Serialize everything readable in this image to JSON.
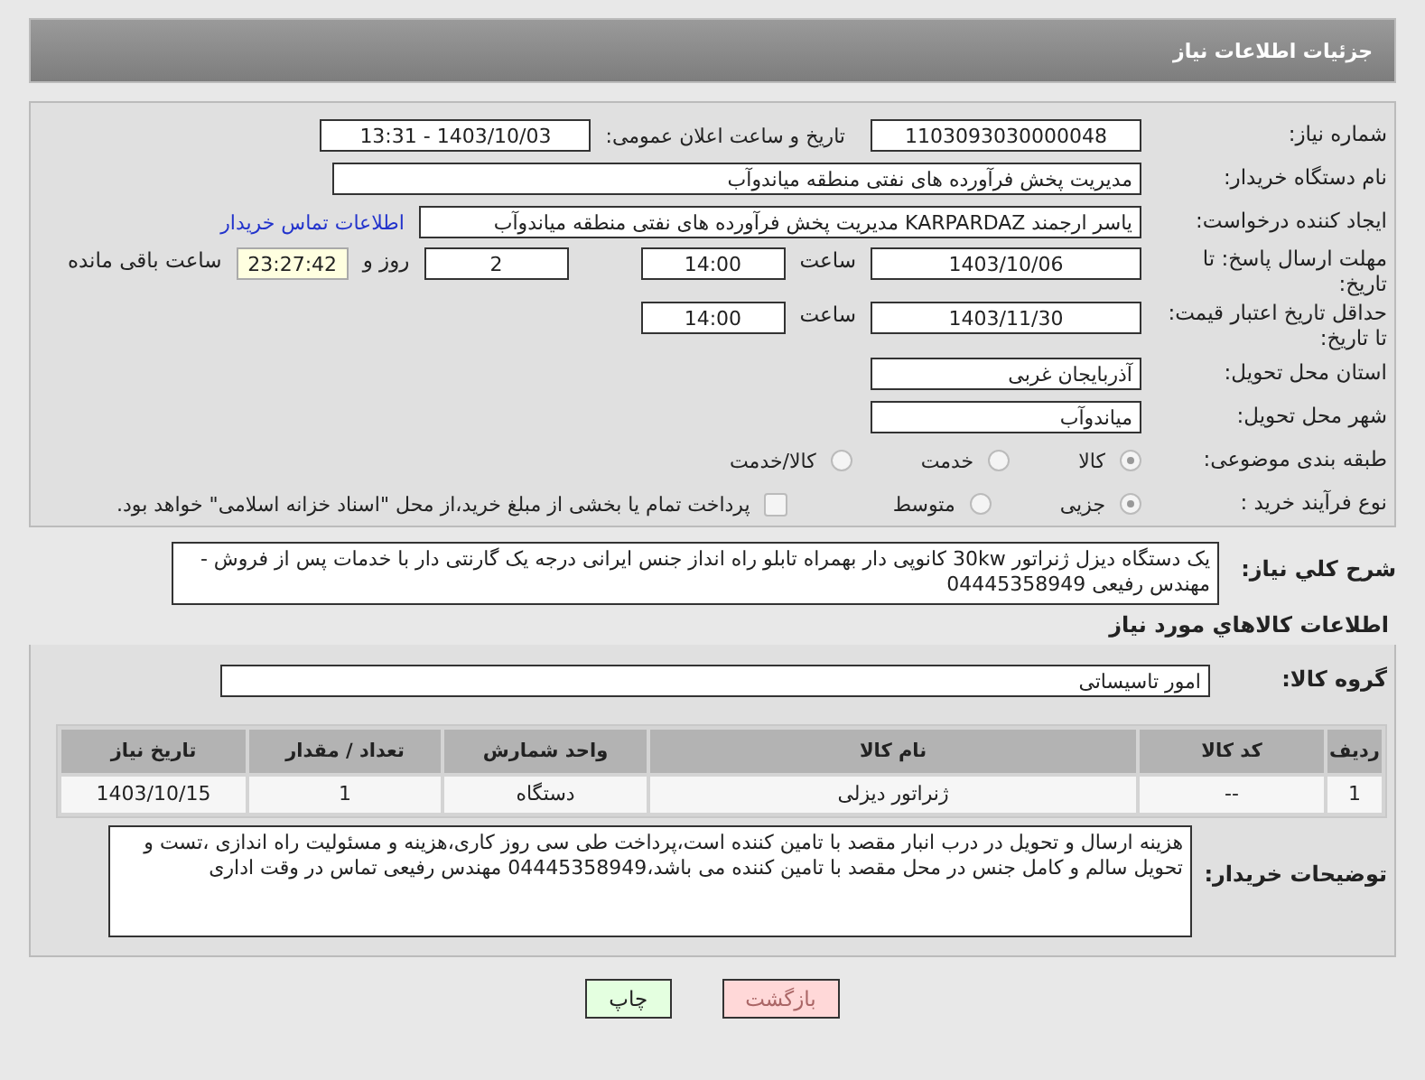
{
  "header": {
    "title": "جزئیات اطلاعات نیاز"
  },
  "need_number": {
    "label": "شماره نیاز:",
    "value": "1103093030000048"
  },
  "announce": {
    "label": "تاریخ و ساعت اعلان عمومی:",
    "value": "1403/10/03 - 13:31"
  },
  "buyer_org": {
    "label": "نام دستگاه خریدار:",
    "value": "مدیریت پخش فرآورده های نفتی منطقه میاندوآب"
  },
  "requester": {
    "label": "ایجاد کننده درخواست:",
    "value": "یاسر ارجمند KARPARDAZ مدیریت پخش فرآورده های نفتی منطقه میاندوآب",
    "link": "اطلاعات تماس خریدار"
  },
  "reply_deadline": {
    "label": "مهلت ارسال پاسخ: تا تاریخ:",
    "date": "1403/10/06",
    "time_label": "ساعت",
    "time": "14:00",
    "days": "2",
    "days_label": "روز و",
    "remaining": "23:27:42",
    "remaining_label": "ساعت باقی مانده"
  },
  "price_validity": {
    "label": "حداقل تاریخ اعتبار قیمت: تا تاریخ:",
    "date": "1403/11/30",
    "time_label": "ساعت",
    "time": "14:00"
  },
  "province": {
    "label": "استان محل تحویل:",
    "value": "آذربایجان غربی"
  },
  "city": {
    "label": "شهر محل تحویل:",
    "value": "میاندوآب"
  },
  "category": {
    "label": "طبقه بندی موضوعی:",
    "options": [
      {
        "label": "کالا",
        "selected": true
      },
      {
        "label": "خدمت",
        "selected": false
      },
      {
        "label": "کالا/خدمت",
        "selected": false
      }
    ]
  },
  "process": {
    "label": "نوع فرآیند خرید :",
    "options": [
      {
        "label": "جزیی",
        "selected": true
      },
      {
        "label": "متوسط",
        "selected": false
      }
    ],
    "treasury": {
      "label": "پرداخت تمام یا بخشی از مبلغ خرید،از محل \"اسناد خزانه اسلامی\" خواهد بود.",
      "checked": false
    }
  },
  "description": {
    "label": "شرح کلي نياز:",
    "value": "یک دستگاه دیزل ژنراتور 30kw کانوپی دار بهمراه تابلو راه انداز جنس ایرانی درجه یک گارنتی دار با خدمات پس از فروش -  مهندس رفیعی 04445358949"
  },
  "items_title": "اطلاعات کالاهاي مورد نياز",
  "goods_group": {
    "label": "گروه کالا:",
    "value": "امور تاسیساتی"
  },
  "table": {
    "columns": [
      "ردیف",
      "کد کالا",
      "نام کالا",
      "واحد شمارش",
      "تعداد / مقدار",
      "تاریخ نیاز"
    ],
    "rows": [
      [
        "1",
        "--",
        "ژنراتور دیزلی",
        "دستگاه",
        "1",
        "1403/10/15"
      ]
    ]
  },
  "buyer_notes": {
    "label": "توضیحات خریدار:",
    "value": "هزینه ارسال و تحویل در درب انبار مقصد با تامین کننده است،پرداخت طی سی روز کاری،هزینه و مسئولیت راه اندازی ،تست و تحویل سالم و کامل جنس در محل مقصد با تامین کننده می باشد،04445358949 مهندس رفیعی تماس در وقت اداری"
  },
  "buttons": [
    {
      "label": "بازگشت",
      "kind": "back"
    },
    {
      "label": "چاپ",
      "kind": "print"
    }
  ]
}
